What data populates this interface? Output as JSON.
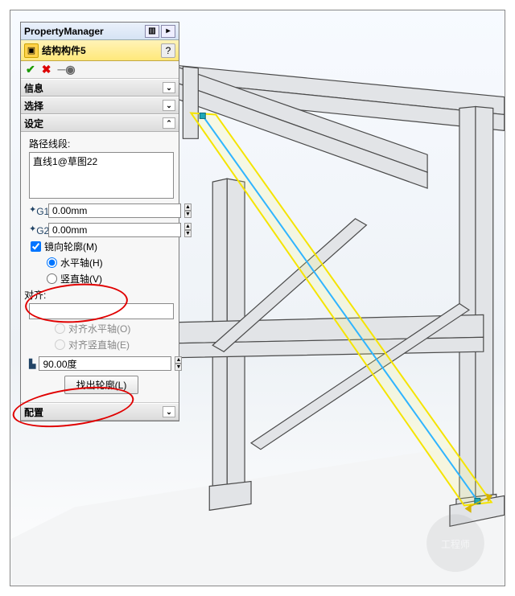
{
  "pm": {
    "title": "PropertyManager",
    "feature_name": "结构构件5",
    "sections": {
      "info": "信息",
      "select": "选择",
      "settings": "设定",
      "config": "配置"
    },
    "settings": {
      "path_seg_label": "路径线段:",
      "path_item": "直线1@草图22",
      "g1_value": "0.00mm",
      "g2_value": "0.00mm",
      "mirror_profile": "镜向轮廓(M)",
      "horiz_axis": "水平轴(H)",
      "vert_axis": "竖直轴(V)",
      "align_label": "对齐:",
      "align_horiz": "对齐水平轴(O)",
      "align_vert": "对齐竖直轴(E)",
      "angle_value": "90.00度",
      "find_profile_btn": "找出轮廓(L)"
    }
  }
}
